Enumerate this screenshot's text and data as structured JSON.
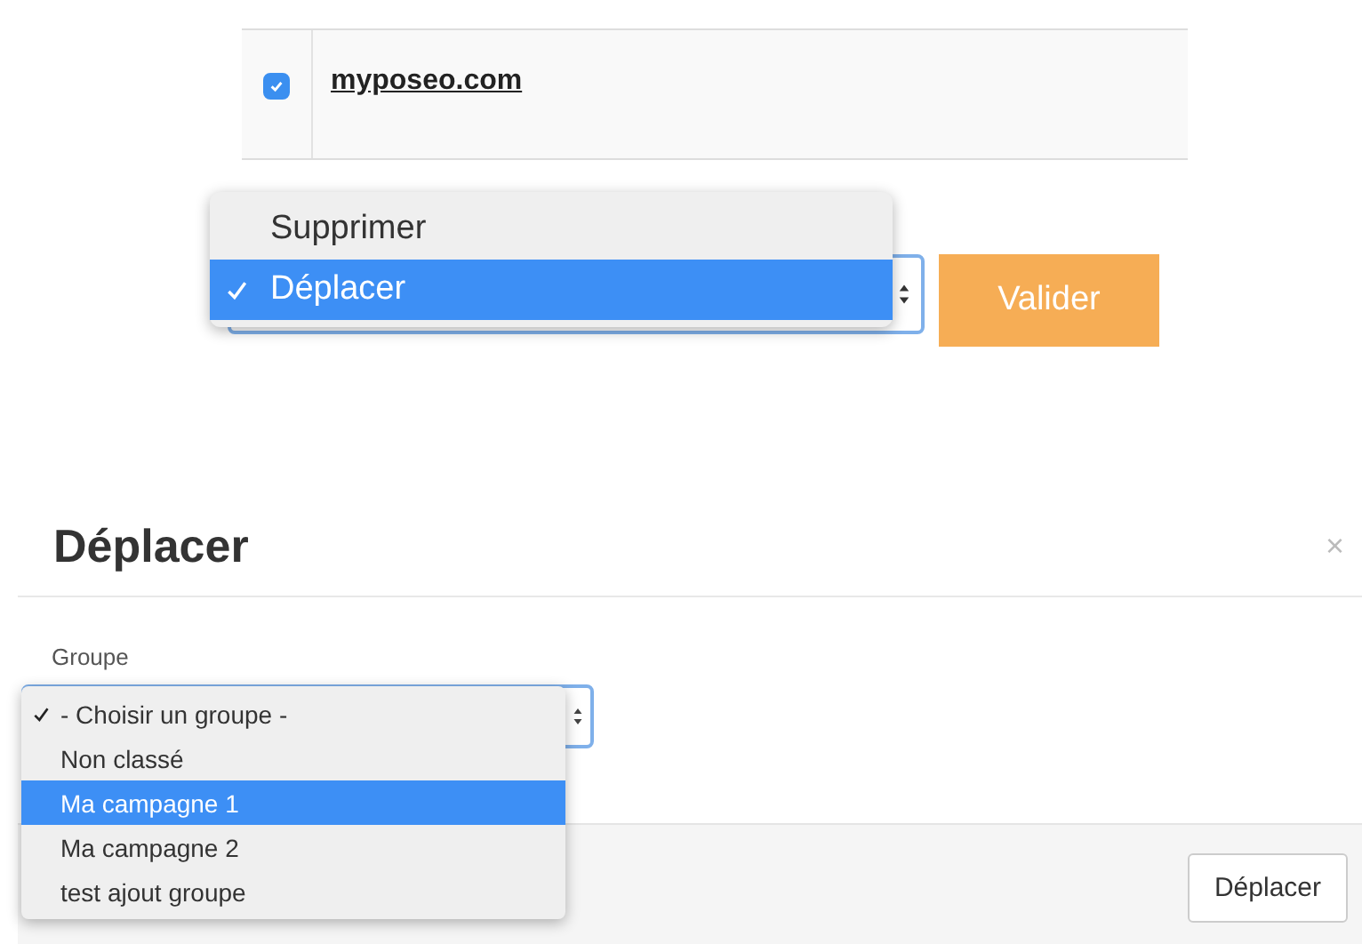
{
  "table": {
    "rows": [
      {
        "checked": true,
        "domain": "myposeo.com"
      }
    ]
  },
  "action_menu": {
    "items": [
      {
        "label": "Supprimer",
        "selected": false,
        "highlighted": false
      },
      {
        "label": "Déplacer",
        "selected": true,
        "highlighted": true
      }
    ]
  },
  "validate_button": "Valider",
  "modal": {
    "title": "Déplacer",
    "close": "×",
    "field_label": "Groupe",
    "group_menu": {
      "items": [
        {
          "label": "- Choisir un groupe -",
          "selected": true,
          "highlighted": false
        },
        {
          "label": "Non classé",
          "selected": false,
          "highlighted": false
        },
        {
          "label": "Ma campagne 1",
          "selected": false,
          "highlighted": true
        },
        {
          "label": "Ma campagne 2",
          "selected": false,
          "highlighted": false
        },
        {
          "label": "test ajout groupe",
          "selected": false,
          "highlighted": false
        }
      ]
    },
    "submit_button": "Déplacer"
  }
}
